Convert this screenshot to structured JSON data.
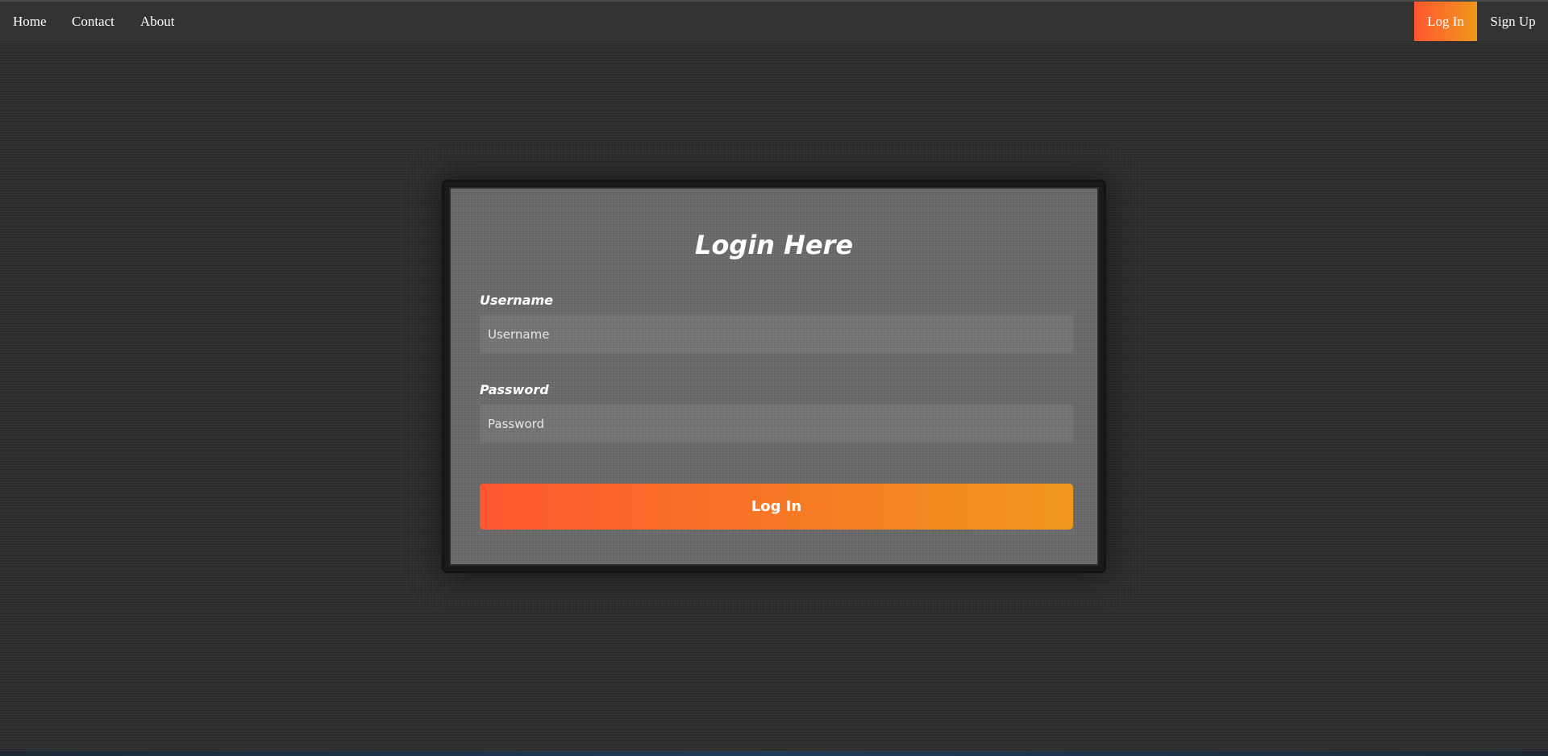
{
  "nav": {
    "left_links": [
      "Home",
      "Contact",
      "About"
    ],
    "login_label": "Log In",
    "signup_label": "Sign Up"
  },
  "form": {
    "title": "Login Here",
    "username_label": "Username",
    "username_placeholder": "Username",
    "username_value": "",
    "password_label": "Password",
    "password_placeholder": "Password",
    "password_value": "",
    "submit_label": "Log In"
  },
  "colors": {
    "accent_start": "#ff5630",
    "accent_end": "#f0981c",
    "navbar_bg": "#333333",
    "page_bg": "#2e2e2e",
    "card_bg": "#6c6c6c"
  }
}
